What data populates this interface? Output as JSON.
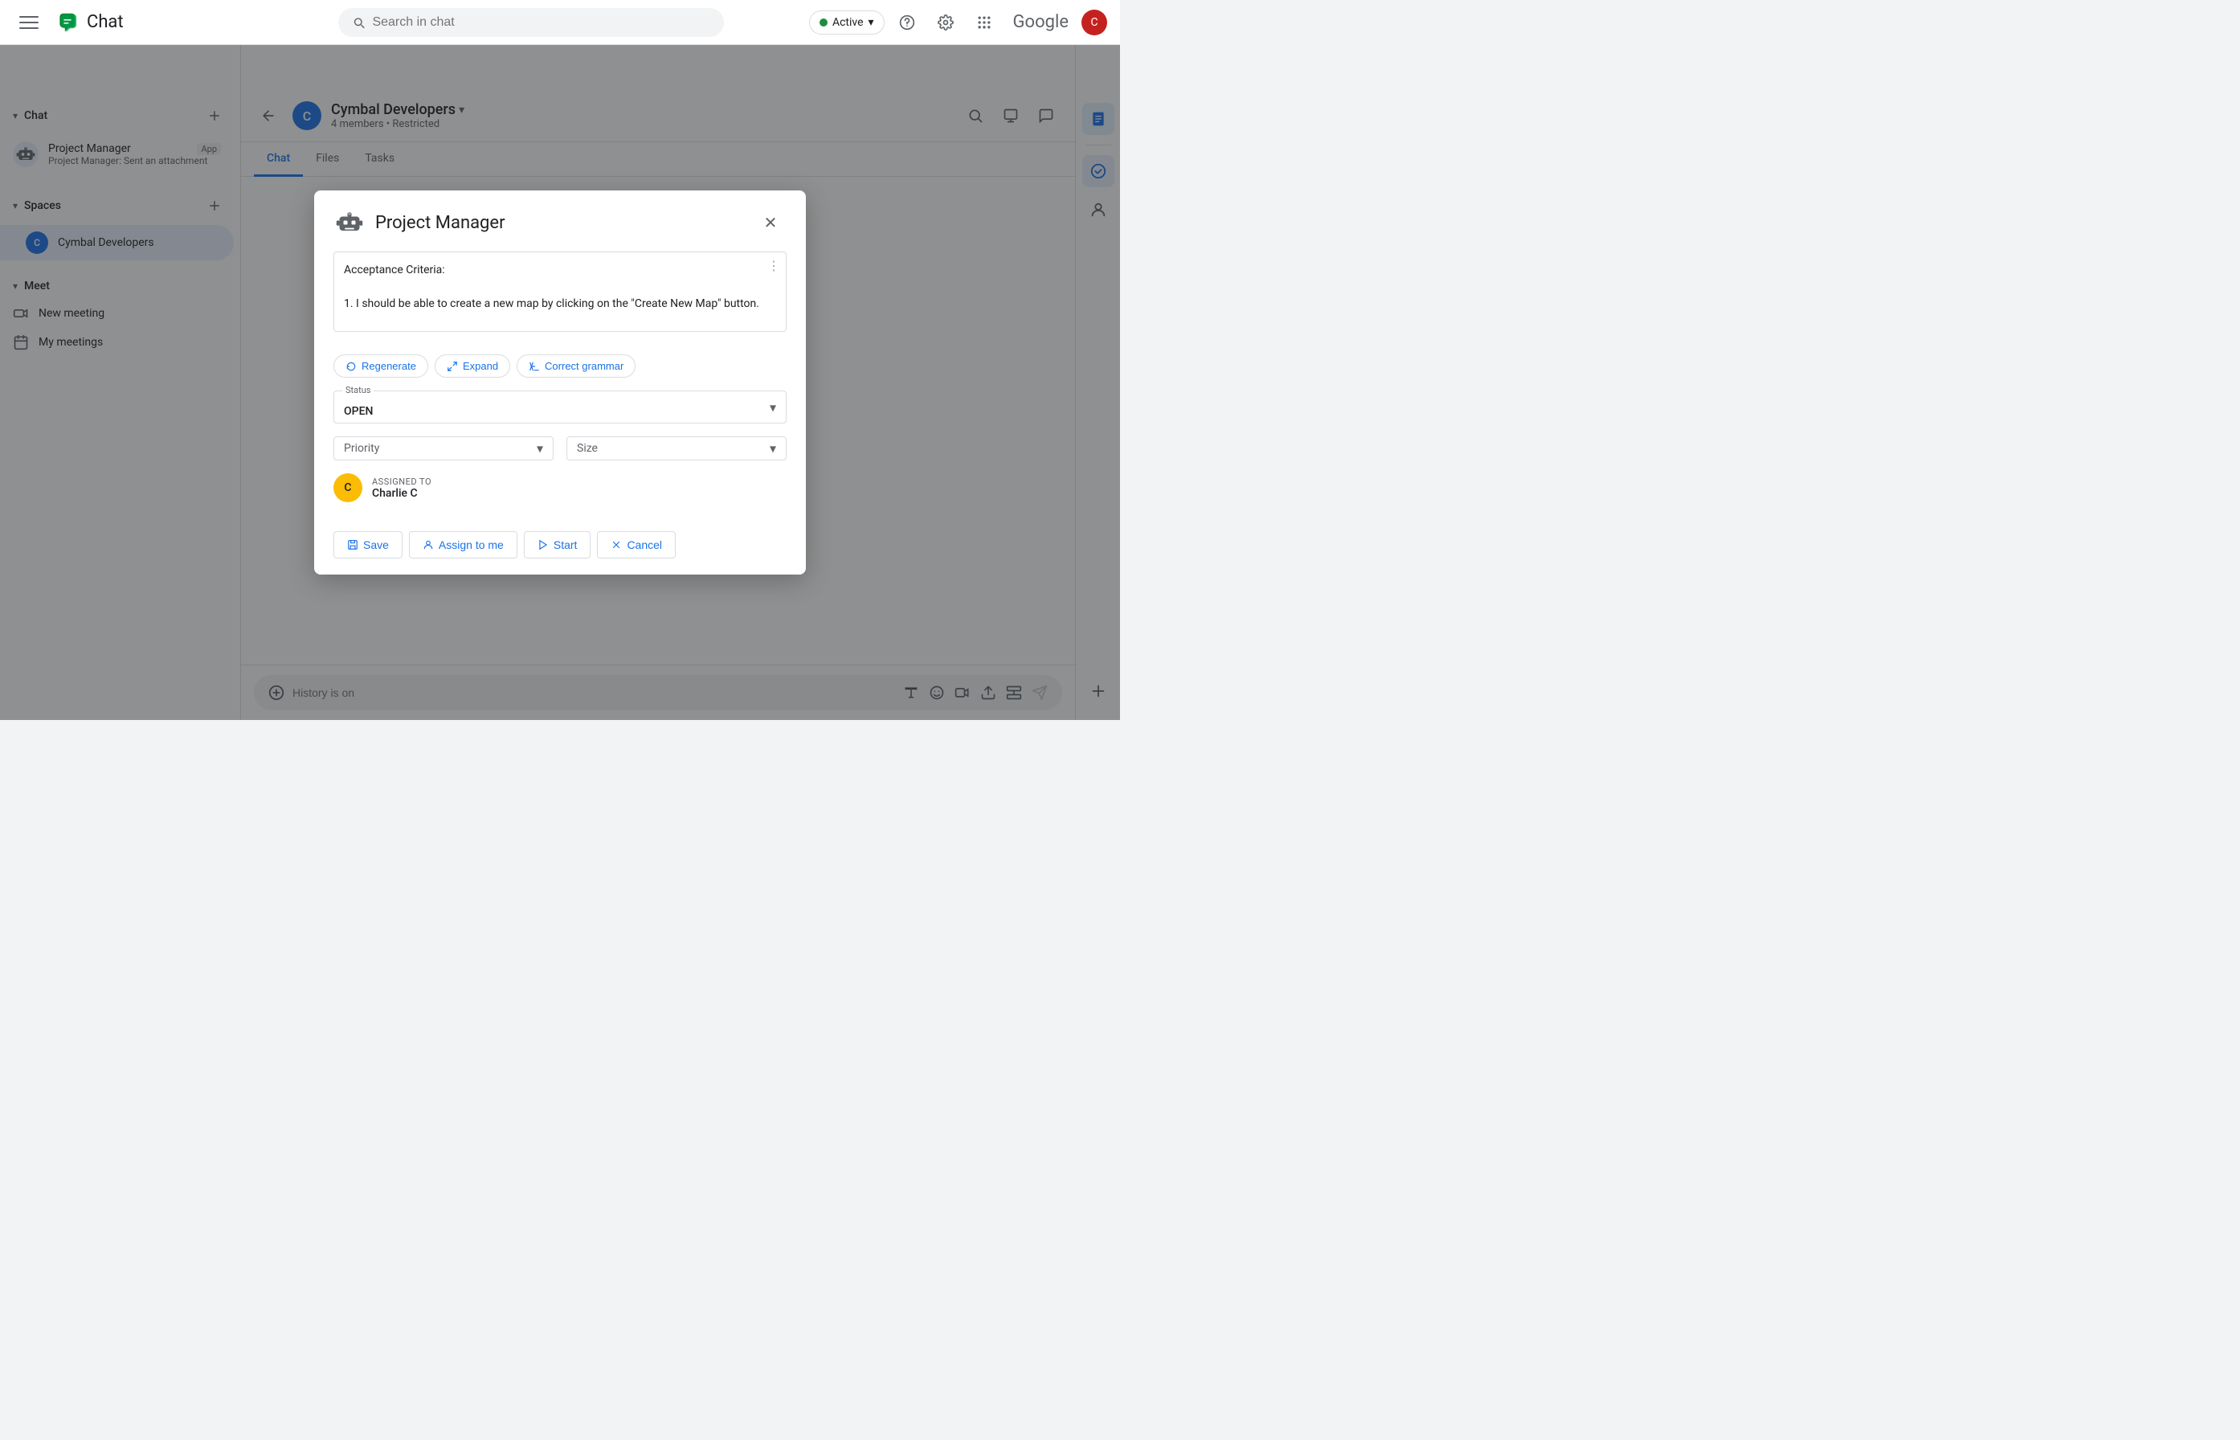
{
  "app": {
    "title": "Chat",
    "search_placeholder": "Search in chat"
  },
  "status": {
    "label": "Active",
    "indicator": "active"
  },
  "sidebar": {
    "chat_section": "Chat",
    "spaces_section": "Spaces",
    "meet_section": "Meet",
    "items": [
      {
        "name": "Project Manager",
        "meta": "App",
        "sub": "Project Manager: Sent an attachment"
      }
    ],
    "spaces": [
      {
        "name": "Cymbal Developers",
        "initial": "C"
      }
    ],
    "meet_items": [
      {
        "name": "New meeting",
        "icon": "video"
      },
      {
        "name": "My meetings",
        "icon": "calendar"
      }
    ]
  },
  "channel": {
    "name": "Cymbal Developers",
    "members": "4 members",
    "restriction": "Restricted",
    "initial": "C"
  },
  "tabs": [
    {
      "label": "Chat",
      "active": true
    },
    {
      "label": "Files",
      "active": false
    },
    {
      "label": "Tasks",
      "active": false
    }
  ],
  "input": {
    "placeholder": "History is on"
  },
  "modal": {
    "title": "Project Manager",
    "textarea_content": "Acceptance Criteria:\n\n1. I should be able to create a new map by clicking on the \"Create New Map\" button.",
    "ai_buttons": [
      {
        "label": "Regenerate",
        "icon": "regenerate"
      },
      {
        "label": "Expand",
        "icon": "expand"
      },
      {
        "label": "Correct grammar",
        "icon": "correct"
      }
    ],
    "status_label": "Status",
    "status_value": "OPEN",
    "priority_label": "Priority",
    "size_label": "Size",
    "assigned_label": "ASSIGNED TO",
    "assigned_name": "Charlie C",
    "assigned_initial": "C",
    "buttons": [
      {
        "label": "Save",
        "icon": "save"
      },
      {
        "label": "Assign to me",
        "icon": "person"
      },
      {
        "label": "Start",
        "icon": "play"
      },
      {
        "label": "Cancel",
        "icon": "close"
      }
    ]
  }
}
